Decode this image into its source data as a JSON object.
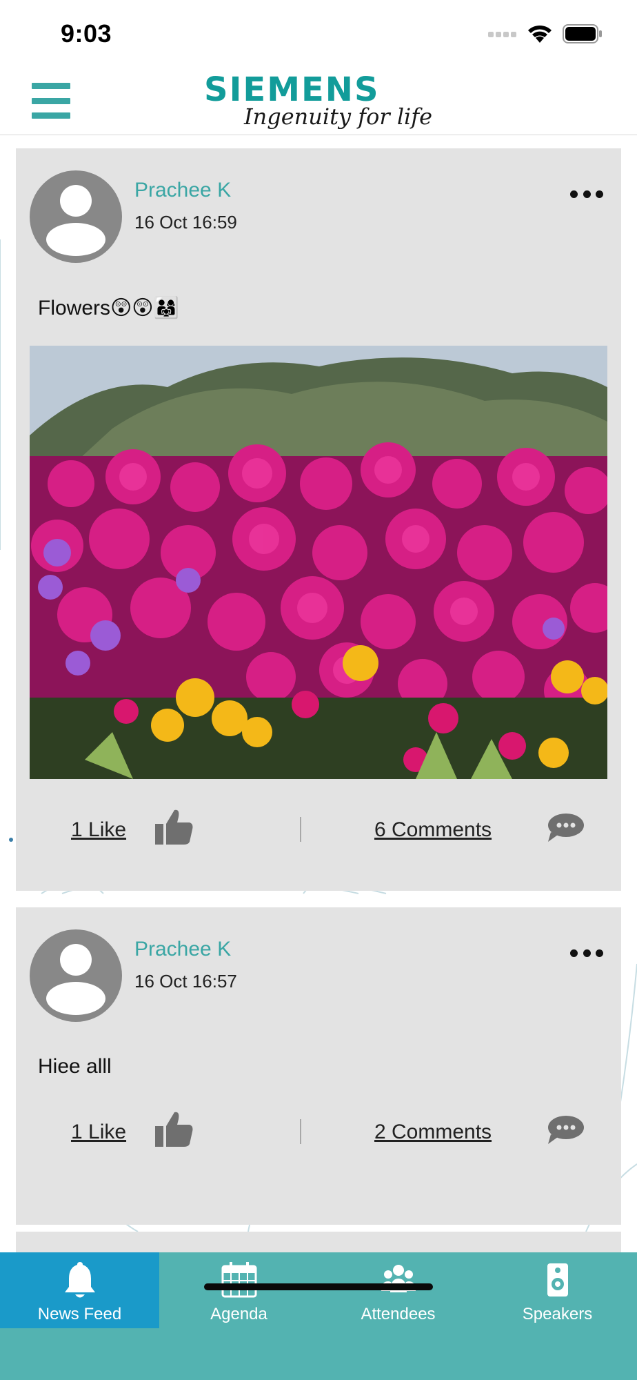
{
  "status_bar": {
    "time": "9:03"
  },
  "header": {
    "brand": "SIEMENS",
    "tagline": "Ingenuity for life"
  },
  "posts": [
    {
      "author": "Prachee K",
      "time": "16 Oct 16:59",
      "text": "Flowers😲😲👨‍👩‍👧",
      "likes_label": "1 Like",
      "comments_label": "6 Comments",
      "has_image": true
    },
    {
      "author": "Prachee K",
      "time": "16 Oct 16:57",
      "text": "Hiee alll",
      "likes_label": "1 Like",
      "comments_label": "2 Comments",
      "has_image": false
    }
  ],
  "tabs": [
    {
      "label": "News Feed",
      "icon": "bell-icon",
      "active": true
    },
    {
      "label": "Agenda",
      "icon": "calendar-icon",
      "active": false
    },
    {
      "label": "Attendees",
      "icon": "people-icon",
      "active": false
    },
    {
      "label": "Speakers",
      "icon": "speaker-icon",
      "active": false
    }
  ],
  "colors": {
    "brand_teal": "#129c9a",
    "author_teal": "#3aa6a4",
    "tabbar": "#53b3b1",
    "tab_active": "#1a9ac9",
    "card_bg": "#e3e3e3"
  }
}
